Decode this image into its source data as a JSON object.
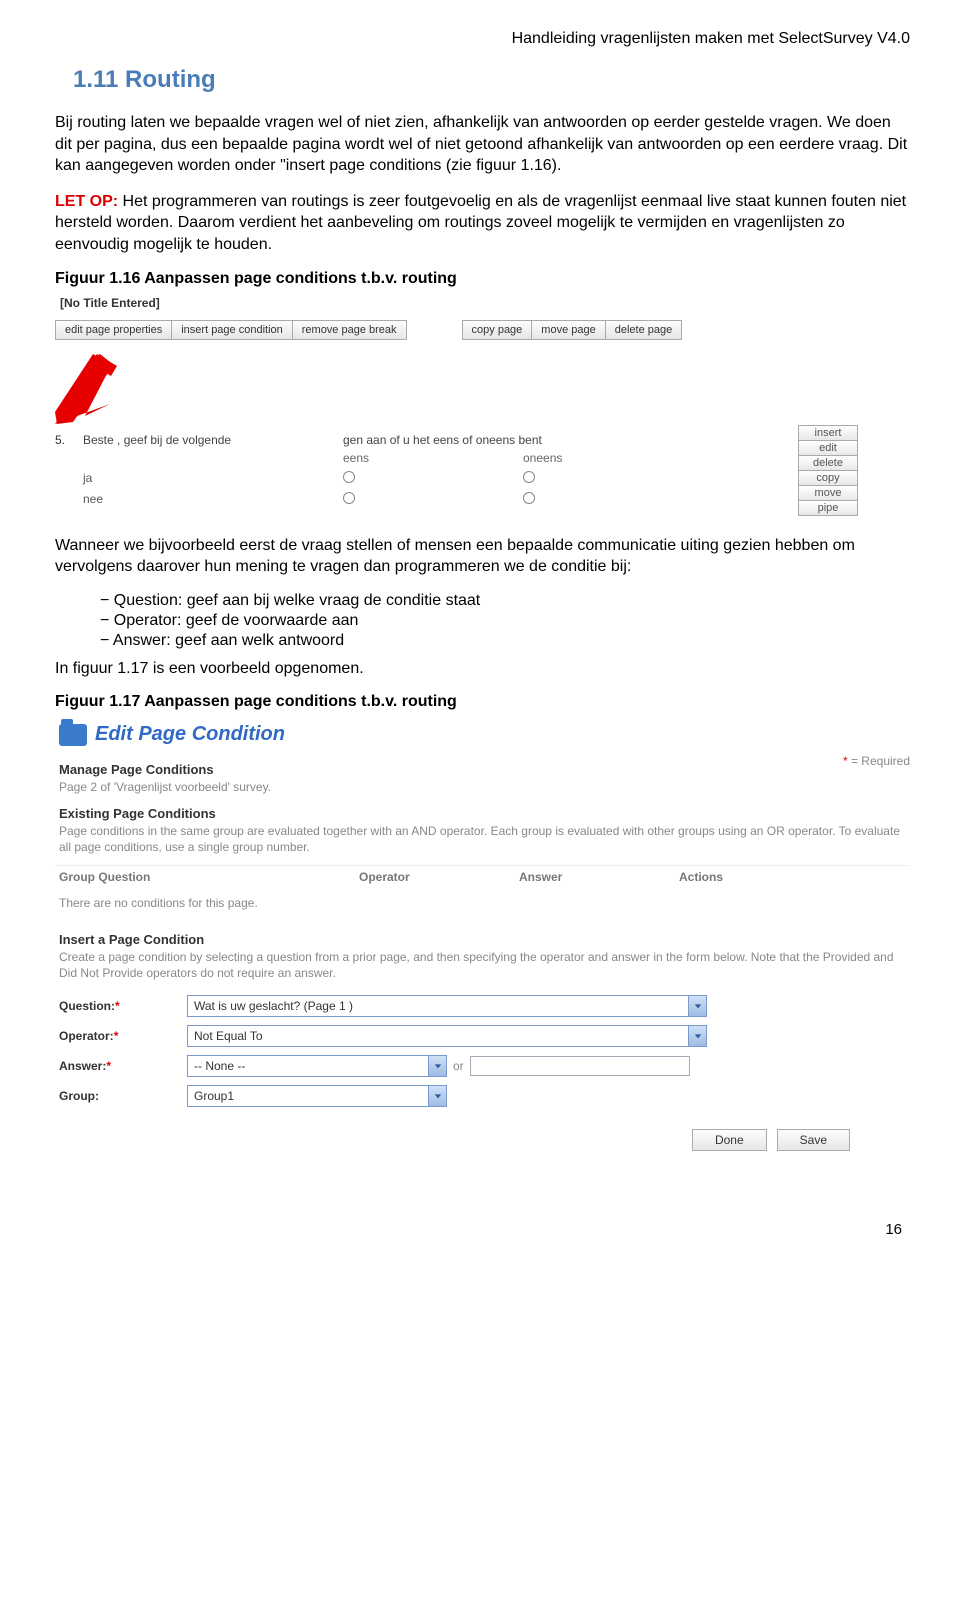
{
  "header": {
    "doc_title": "Handleiding vragenlijsten maken met SelectSurvey V4.0"
  },
  "section": {
    "heading": "1.11 Routing",
    "p1": "Bij routing laten we bepaalde vragen wel of niet zien, afhankelijk van antwoorden op eerder gestelde vragen. We doen dit per pagina, dus een bepaalde pagina wordt wel of niet getoond afhankelijk van antwoorden op een eerdere vraag. Dit kan aangegeven worden onder \"insert page conditions (zie figuur 1.16).",
    "warn_label": "LET OP:",
    "warn_text": " Het programmeren van routings is zeer foutgevoelig en als de vragenlijst eenmaal live staat kunnen fouten niet hersteld worden. Daarom verdient het aanbeveling om routings zoveel mogelijk te vermijden en vragenlijsten zo eenvoudig mogelijk te houden.",
    "fig116_label": "Figuur 1.16 Aanpassen page conditions t.b.v. routing",
    "mid_p": "Wanneer we bijvoorbeeld eerst de vraag stellen of mensen een bepaalde communicatie uiting gezien hebben om vervolgens daarover hun mening te vragen dan programmeren we de conditie bij:",
    "bullets": [
      "Question: geef aan bij welke vraag de conditie staat",
      "Operator: geef de voorwaarde aan",
      "Answer: geef aan welk antwoord"
    ],
    "after_bullets": " In figuur 1.17 is een voorbeeld opgenomen.",
    "fig117_label": "Figuur 1.17 Aanpassen page conditions t.b.v. routing"
  },
  "fig116": {
    "no_title": "[No Title Entered]",
    "toolbar_left": [
      "edit page properties",
      "insert page condition",
      "remove page break"
    ],
    "toolbar_right": [
      "copy page",
      "move page",
      "delete page"
    ],
    "q_num": "5.",
    "q_text_a": "Beste , geef bij de volgende",
    "q_text_b": "gen aan of u het eens of oneens bent",
    "col1": "eens",
    "col2": "oneens",
    "row1": "ja",
    "row2": "nee",
    "side_buttons": [
      "insert",
      "edit",
      "delete",
      "copy",
      "move",
      "pipe"
    ]
  },
  "fig117": {
    "panel_title": "Edit Page Condition",
    "manage_head": "Manage Page Conditions",
    "manage_sub": "Page 2 of 'Vragenlijst voorbeeld' survey.",
    "required_note": " = Required",
    "existing_head": "Existing Page Conditions",
    "existing_sub": "Page conditions in the same group are evaluated together with an AND operator. Each group is evaluated with other groups using an OR operator. To evaluate all page conditions, use a single group number.",
    "cols": {
      "group_q": "Group Question",
      "operator": "Operator",
      "answer": "Answer",
      "actions": "Actions"
    },
    "empty_msg": "There are no conditions for this page.",
    "insert_head": "Insert a Page Condition",
    "insert_sub": "Create a page condition by selecting a question from a prior page, and then specifying the operator and answer in the form below. Note that the Provided and Did Not Provide operators do not require an answer.",
    "labels": {
      "question": "Question:",
      "operator": "Operator:",
      "answer": "Answer:",
      "group": "Group:"
    },
    "values": {
      "question": "Wat is uw geslacht? (Page 1 )",
      "operator": "Not Equal To",
      "answer": "-- None --",
      "group": "Group1"
    },
    "or": "or",
    "buttons": {
      "done": "Done",
      "save": "Save"
    }
  },
  "footer": {
    "page_num": "16"
  }
}
